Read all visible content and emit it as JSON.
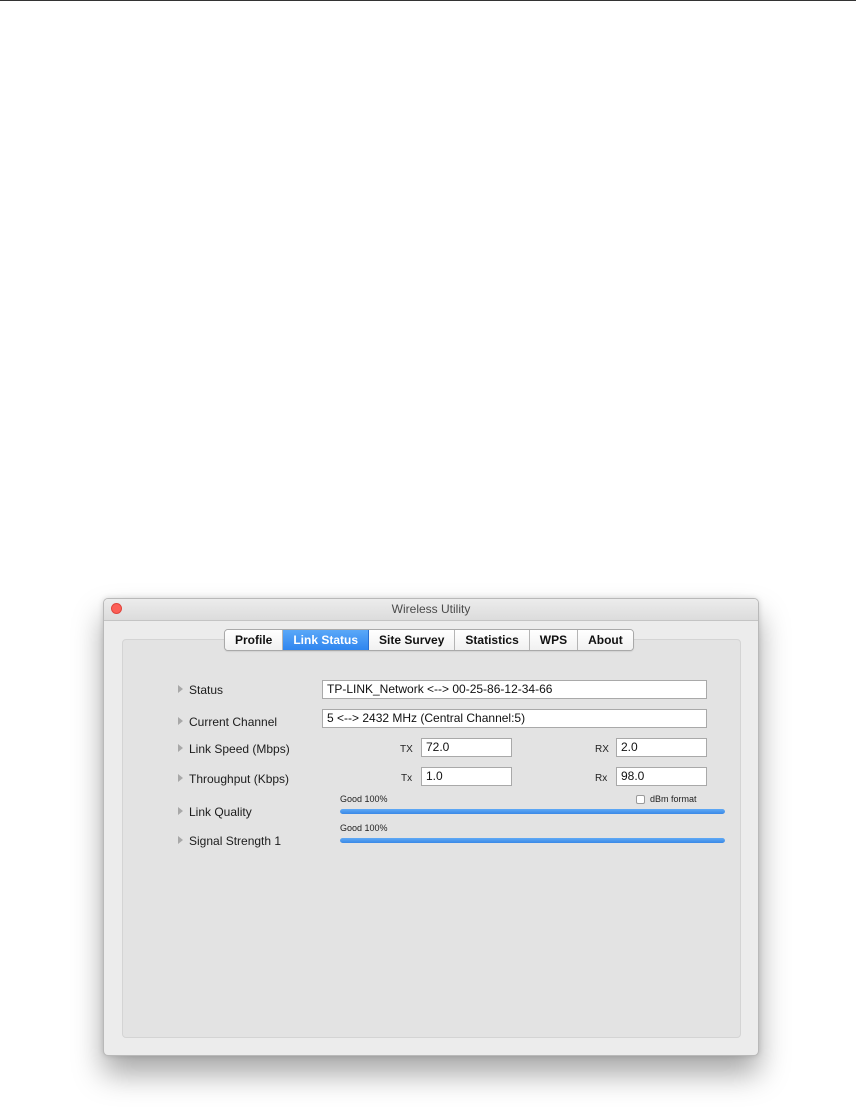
{
  "window": {
    "title": "Wireless Utility"
  },
  "tabs": [
    {
      "label": "Profile",
      "active": false
    },
    {
      "label": "Link Status",
      "active": true
    },
    {
      "label": "Site Survey",
      "active": false
    },
    {
      "label": "Statistics",
      "active": false
    },
    {
      "label": "WPS",
      "active": false
    },
    {
      "label": "About",
      "active": false
    }
  ],
  "rows": {
    "status": {
      "label": "Status",
      "value": "TP-LINK_Network <--> 00-25-86-12-34-66"
    },
    "current_channel": {
      "label": "Current Channel",
      "value": "5 <--> 2432 MHz (Central Channel:5)"
    },
    "link_speed": {
      "label": "Link Speed (Mbps)",
      "tx_label": "TX",
      "tx_value": "72.0",
      "rx_label": "RX",
      "rx_value": "2.0"
    },
    "throughput": {
      "label": "Throughput (Kbps)",
      "tx_label": "Tx",
      "tx_value": "1.0",
      "rx_label": "Rx",
      "rx_value": "98.0"
    },
    "link_quality": {
      "label": "Link Quality",
      "caption": "Good 100%",
      "percent": 100,
      "dbm_label": "dBm format",
      "dbm_checked": false
    },
    "signal_strength": {
      "label": "Signal Strength 1",
      "caption": "Good 100%",
      "percent": 100
    }
  },
  "colors": {
    "accent": "#2f85ef",
    "bar": "#3a89e6",
    "close": "#fc5f57"
  }
}
